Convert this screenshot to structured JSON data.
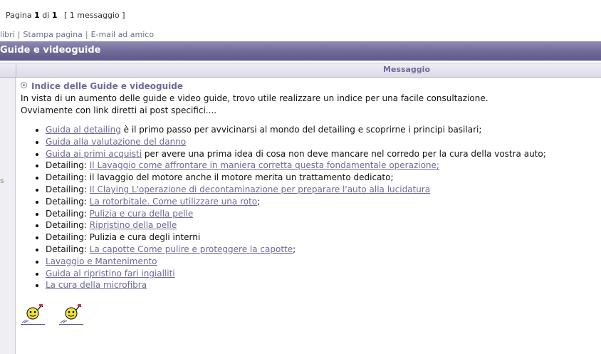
{
  "pager": {
    "prefix": "Pagina",
    "current": "1",
    "of": "di",
    "total": "1",
    "count": "[ 1 messaggio ]"
  },
  "linkbar": {
    "item0": "libri",
    "sep": "|",
    "item1": "Stampa pagina",
    "item2": "E-mail ad amico"
  },
  "topic_title": "Guide e videoguide",
  "table_header": "Messaggio",
  "left_fragment": "s",
  "post": {
    "title": "Indice delle Guide e videoguide",
    "line1": "In vista di un aumento delle guide e video guide, trovo utile realizzare un indice per una facile consultazione.",
    "line2": "Ovviamente con link diretti ai post specifici....",
    "items": [
      {
        "prefix": "",
        "link": "Guida al detailing",
        "suffix": " è il primo passo per avvicinarsi al mondo del detailing e scoprirne i principi basilari;"
      },
      {
        "prefix": "",
        "link": "Guida alla valutazione del danno",
        "suffix": ""
      },
      {
        "prefix": "",
        "link": "Guida ai primi acquisti",
        "suffix": " per avere una prima idea di cosa non deve mancare nel corredo per la cura della vostra auto;"
      },
      {
        "prefix": "Detailing: ",
        "link": "Il Lavaggio come affrontare in maniera corretta questa fondamentale operazione;",
        "suffix": ""
      },
      {
        "prefix": "Detailing: il lavaggio del motore anche il motore merita un trattamento dedicato;",
        "link": "",
        "suffix": ""
      },
      {
        "prefix": "Detailing: ",
        "link": "Il Claying L'operazione di decontaminazione per preparare l'auto alla lucidatura",
        "suffix": ""
      },
      {
        "prefix": "Detailing: ",
        "link": "La rotorbitale. Come utilizzare una roto",
        "suffix": ";"
      },
      {
        "prefix": "Detailing: ",
        "link": "Pulizia e cura della pelle",
        "suffix": ""
      },
      {
        "prefix": "Detailing: ",
        "link": "Ripristino della pelle",
        "suffix": ""
      },
      {
        "prefix": "Detailing: Pulizia e cura degli interni",
        "link": "",
        "suffix": ""
      },
      {
        "prefix": "Detailing: ",
        "link": "La capotte Come pulire e proteggere la capotte",
        "suffix": ";"
      },
      {
        "prefix": "",
        "link": "Lavaggio e Mantenimento",
        "suffix": ""
      },
      {
        "prefix": "",
        "link": "Guida al ripristino fari ingialliti",
        "suffix": ""
      },
      {
        "prefix": "",
        "link": "La cura della microfibra",
        "suffix": ""
      }
    ],
    "smileys": [
      "smiley-waving-icon",
      "smiley-waving-icon"
    ]
  },
  "colors": {
    "accent": "#6d6a98",
    "header_bar": "#6f6b98",
    "subheader": "#e4e3ed"
  }
}
